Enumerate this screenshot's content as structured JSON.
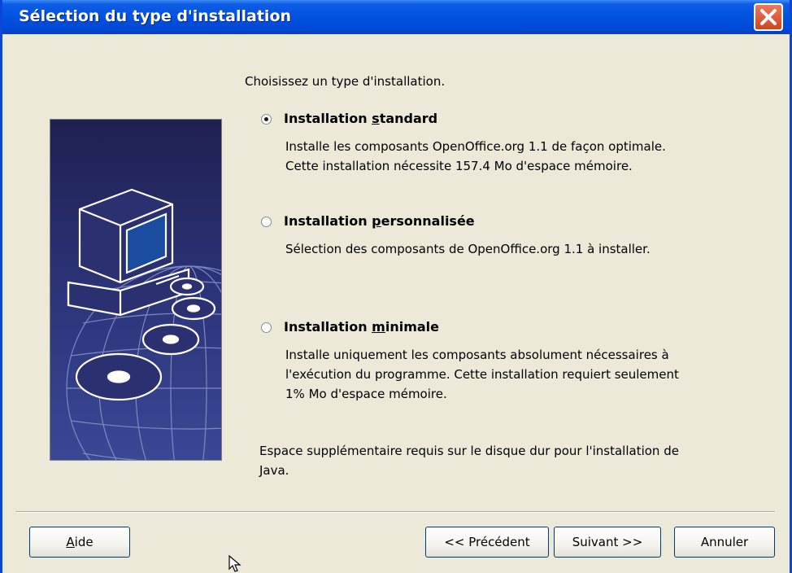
{
  "window": {
    "title": "Sélection du type d'installation"
  },
  "instruction": "Choisissez un type d'installation.",
  "options": [
    {
      "label_pre": "Installation ",
      "label_accel": "s",
      "label_post": "tandard",
      "description": "Installe les composants OpenOffice.org 1.1 de façon optimale.\nCette installation nécessite 157.4 Mo d'espace mémoire.",
      "selected": true
    },
    {
      "label_pre": "Installation ",
      "label_accel": "p",
      "label_post": "ersonnalisée",
      "description": "Sélection des composants de OpenOffice.org 1.1 à installer.",
      "selected": false
    },
    {
      "label_pre": "Installation ",
      "label_accel": "m",
      "label_post": "inimale",
      "description": "Installe uniquement les composants absolument nécessaires à\nl'exécution du programme. Cette installation requiert seulement\n1% Mo d'espace mémoire.",
      "selected": false
    }
  ],
  "java_note": "Espace supplémentaire requis sur le disque dur pour l'installation de\nJava.",
  "buttons": {
    "help_accel": "A",
    "help_rest": "ide",
    "back": "<< Précédent",
    "next": "Suivant >>",
    "cancel": "Annuler"
  },
  "colors": {
    "titlebar": "#0052e0",
    "dialog_bg": "#ece9d8",
    "close_button": "#d2451f",
    "side_panel": "#2a3070"
  }
}
